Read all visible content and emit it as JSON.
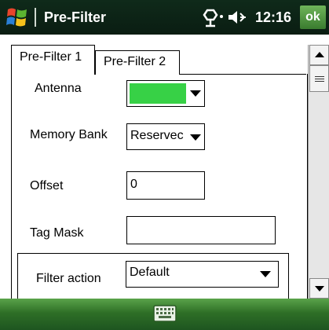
{
  "titlebar": {
    "title": "Pre-Filter",
    "time": "12:16",
    "ok_label": "ok"
  },
  "tabs": [
    {
      "label": "Pre-Filter 1",
      "active": true
    },
    {
      "label": "Pre-Filter 2",
      "active": false
    }
  ],
  "form": {
    "antenna": {
      "label": "Antenna",
      "value": "",
      "swatch_color": "#37d146"
    },
    "memory_bank": {
      "label": "Memory Bank",
      "value": "Reservec"
    },
    "offset": {
      "label": "Offset",
      "value": "0"
    },
    "tag_mask": {
      "label": "Tag Mask",
      "value": ""
    },
    "filter_action": {
      "label": "Filter action",
      "value": "Default"
    }
  },
  "icons": {
    "start": "windows-start-icon",
    "connectivity": "connectivity-icon",
    "volume": "speaker-volume-icon",
    "keyboard": "keyboard-icon"
  },
  "colors": {
    "titlebar": "#0f2a1a",
    "bottombar": "#3c8a35",
    "ok_button": "#4f9a40"
  }
}
